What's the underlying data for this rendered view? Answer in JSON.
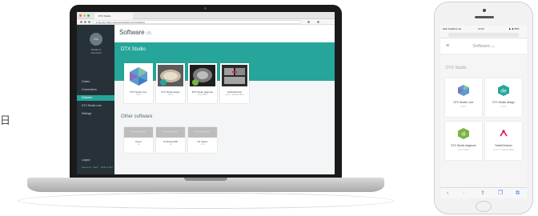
{
  "stray_glyph": "日",
  "laptop": {
    "browser": {
      "tab_label": "DTX Studio",
      "url": "● Secure   https://portal.dtxstudio.com/software"
    },
    "sidebar": {
      "avatar_initials": "DA",
      "user_name": "Builder &\nAssociate",
      "items": [
        {
          "label": "Orders",
          "active": false
        },
        {
          "label": "Connections",
          "active": false
        },
        {
          "label": "Software",
          "active": true
        },
        {
          "label": "DTX Studio core",
          "active": false
        },
        {
          "label": "Settings",
          "active": false
        }
      ],
      "logout": "Logout",
      "footer_left": "About us · FAQ",
      "footer_right": "Help & Info"
    },
    "main": {
      "title": "Software",
      "count": "(4)",
      "band_title": "DTX Studio",
      "cards": [
        {
          "name": "DTX Studio Core",
          "sub": "v3.0.1",
          "art": "core"
        },
        {
          "name": "DTX Studio design",
          "sub": "v1.0.2",
          "art": "design"
        },
        {
          "name": "DTX Studio diagnose",
          "sub": "v2.4.0 PRO",
          "art": "diagnose"
        },
        {
          "name": "NobelClinician",
          "sub": "v2.5.1 - Windows Beta",
          "art": "clinician"
        }
      ],
      "other_title": "Other software",
      "other_cards": [
        {
          "head": "No image available",
          "name": "Xenon",
          "sub": "v4"
        },
        {
          "name": "OnDemand3D",
          "sub": "v4",
          "head": "No image available"
        },
        {
          "name": "CS Viewer",
          "sub": "v.3.0",
          "head": "No image available"
        }
      ]
    }
  },
  "phone": {
    "status": {
      "carrier": "●●● Vodafone.de",
      "time": "14:26",
      "battery": "▶ ♟ 89%"
    },
    "title": "Software",
    "count": "(4)",
    "section": "DTX Studio",
    "cards": [
      {
        "name": "DTX Studio Core",
        "sub": "v3.0.1",
        "icon": "core"
      },
      {
        "name": "DTX Studio design",
        "sub": "v1.0.2",
        "icon": "design"
      },
      {
        "name": "DTX Studio diagnose",
        "sub": "v2.4.0 PRO",
        "icon": "diagnose"
      },
      {
        "name": "NobelClinician",
        "sub": "v2.5.1 - Windows Beta",
        "icon": "clinician"
      }
    ],
    "toolbar": [
      "‹",
      "›",
      "⇧",
      "❐",
      "⧉"
    ]
  },
  "colors": {
    "accent": "#26a69a",
    "sidebar": "#263238",
    "clinician": "#d81b60",
    "diagnose": "#7cb342"
  }
}
